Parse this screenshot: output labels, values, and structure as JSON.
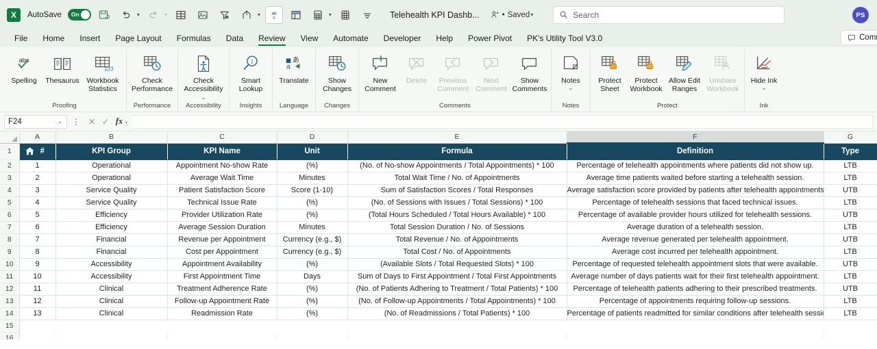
{
  "titlebar": {
    "app_logo": "X",
    "autosave_label": "AutoSave",
    "autosave_state": "On",
    "document_title": "Telehealth KPI Dashb...",
    "save_status": "Saved",
    "search_placeholder": "Search",
    "avatar_initials": "PS",
    "quick_access_icons": [
      "save-icon",
      "undo-icon",
      "redo-icon",
      "table-icon",
      "insert-picture-icon",
      "filter-icon",
      "share-icon",
      "spelling-icon",
      "pivot-table-icon",
      "calculation-icon",
      "sheet-icon",
      "customize-toolbar-icon"
    ]
  },
  "tabs": [
    {
      "label": "File",
      "active": false
    },
    {
      "label": "Home",
      "active": false
    },
    {
      "label": "Insert",
      "active": false
    },
    {
      "label": "Page Layout",
      "active": false
    },
    {
      "label": "Formulas",
      "active": false
    },
    {
      "label": "Data",
      "active": false
    },
    {
      "label": "Review",
      "active": true
    },
    {
      "label": "View",
      "active": false
    },
    {
      "label": "Automate",
      "active": false
    },
    {
      "label": "Developer",
      "active": false
    },
    {
      "label": "Help",
      "active": false
    },
    {
      "label": "Power Pivot",
      "active": false
    },
    {
      "label": "PK's Utility Tool V3.0",
      "active": false
    }
  ],
  "comments_button": "Comm",
  "ribbon": {
    "groups": [
      {
        "label": "Proofing",
        "buttons": [
          {
            "label": "Spelling",
            "icon": "spelling-abc-icon",
            "disabled": false,
            "caret": false
          },
          {
            "label": "Thesaurus",
            "icon": "thesaurus-book-icon",
            "disabled": false,
            "caret": false
          },
          {
            "label": "Workbook Statistics",
            "icon": "workbook-statistics-icon",
            "disabled": false,
            "caret": false
          }
        ]
      },
      {
        "label": "Performance",
        "buttons": [
          {
            "label": "Check Performance",
            "icon": "check-performance-icon",
            "disabled": false,
            "caret": false
          }
        ]
      },
      {
        "label": "Accessibility",
        "buttons": [
          {
            "label": "Check Accessibility",
            "icon": "check-accessibility-icon",
            "disabled": false,
            "caret": true
          }
        ]
      },
      {
        "label": "Insights",
        "buttons": [
          {
            "label": "Smart Lookup",
            "icon": "smart-lookup-icon",
            "disabled": false,
            "caret": false
          }
        ]
      },
      {
        "label": "Language",
        "buttons": [
          {
            "label": "Translate",
            "icon": "translate-icon",
            "disabled": false,
            "caret": false
          }
        ]
      },
      {
        "label": "Changes",
        "buttons": [
          {
            "label": "Show Changes",
            "icon": "show-changes-icon",
            "disabled": false,
            "caret": false
          }
        ]
      },
      {
        "label": "Comments",
        "buttons": [
          {
            "label": "New Comment",
            "icon": "new-comment-icon",
            "disabled": false,
            "caret": false
          },
          {
            "label": "Delete",
            "icon": "delete-comment-icon",
            "disabled": true,
            "caret": false
          },
          {
            "label": "Previous Comment",
            "icon": "previous-comment-icon",
            "disabled": true,
            "caret": false
          },
          {
            "label": "Next Comment",
            "icon": "next-comment-icon",
            "disabled": true,
            "caret": false
          },
          {
            "label": "Show Comments",
            "icon": "show-comments-icon",
            "disabled": false,
            "caret": false
          }
        ]
      },
      {
        "label": "Notes",
        "buttons": [
          {
            "label": "Notes",
            "icon": "notes-icon",
            "disabled": false,
            "caret": true
          }
        ]
      },
      {
        "label": "Protect",
        "buttons": [
          {
            "label": "Protect Sheet",
            "icon": "protect-sheet-icon",
            "disabled": false,
            "caret": false
          },
          {
            "label": "Protect Workbook",
            "icon": "protect-workbook-icon",
            "disabled": false,
            "caret": false
          },
          {
            "label": "Allow Edit Ranges",
            "icon": "allow-edit-ranges-icon",
            "disabled": false,
            "caret": false
          },
          {
            "label": "Unshare Workbook",
            "icon": "unshare-workbook-icon",
            "disabled": true,
            "caret": false
          }
        ]
      },
      {
        "label": "Ink",
        "buttons": [
          {
            "label": "Hide Ink",
            "icon": "hide-ink-icon",
            "disabled": false,
            "caret": true
          }
        ]
      }
    ]
  },
  "formula_bar": {
    "name_box": "F24",
    "formula_value": "",
    "cancel_icon": "cancel-icon",
    "enter_icon": "enter-icon",
    "fx_icon": "insert-function-icon"
  },
  "grid": {
    "column_letters": [
      "A",
      "B",
      "C",
      "D",
      "E",
      "F",
      "G"
    ],
    "selected_column": "F",
    "row_numbers": [
      "1",
      "2",
      "3",
      "4",
      "5",
      "6",
      "7",
      "8",
      "9",
      "10",
      "11",
      "12",
      "13",
      "14",
      "15",
      "16"
    ],
    "header_icon": "home-icon",
    "headers": [
      "#",
      "KPI Group",
      "KPI Name",
      "Unit",
      "Formula",
      "Definition",
      "Type"
    ],
    "rows": [
      {
        "num": "1",
        "group": "Operational",
        "name": "Appointment No-show Rate",
        "unit": "(%)",
        "formula": "(No. of No-show Appointments / Total Appointments) * 100",
        "definition": "Percentage of telehealth appointments where patients did not show up.",
        "type": "LTB"
      },
      {
        "num": "2",
        "group": "Operational",
        "name": "Average Wait Time",
        "unit": "Minutes",
        "formula": "Total Wait Time / No. of Appointments",
        "definition": "Average time patients waited before starting a telehealth session.",
        "type": "LTB"
      },
      {
        "num": "3",
        "group": "Service Quality",
        "name": "Patient Satisfaction Score",
        "unit": "Score (1-10)",
        "formula": "Sum of Satisfaction Scores / Total Responses",
        "definition": "Average satisfaction score provided by patients after telehealth appointments.",
        "type": "UTB"
      },
      {
        "num": "4",
        "group": "Service Quality",
        "name": "Technical Issue Rate",
        "unit": "(%)",
        "formula": "(No. of Sessions with Issues / Total Sessions) * 100",
        "definition": "Percentage of telehealth sessions that faced technical issues.",
        "type": "LTB"
      },
      {
        "num": "5",
        "group": "Efficiency",
        "name": "Provider Utilization Rate",
        "unit": "(%)",
        "formula": "(Total Hours Scheduled / Total Hours Available) * 100",
        "definition": "Percentage of available provider hours utilized for telehealth sessions.",
        "type": "UTB"
      },
      {
        "num": "6",
        "group": "Efficiency",
        "name": "Average Session Duration",
        "unit": "Minutes",
        "formula": "Total Session Duration / No. of Sessions",
        "definition": "Average duration of a telehealth session.",
        "type": "LTB"
      },
      {
        "num": "7",
        "group": "Financial",
        "name": "Revenue per Appointment",
        "unit": "Currency (e.g., $)",
        "formula": "Total Revenue / No. of Appointments",
        "definition": "Average revenue generated per telehealth appointment.",
        "type": "UTB"
      },
      {
        "num": "8",
        "group": "Financial",
        "name": "Cost per Appointment",
        "unit": "Currency (e.g., $)",
        "formula": "Total Cost / No. of Appointments",
        "definition": "Average cost incurred per telehealth appointment.",
        "type": "LTB"
      },
      {
        "num": "9",
        "group": "Accessibility",
        "name": "Appointment Availability",
        "unit": "(%)",
        "formula": "(Available Slots / Total Requested Slots) * 100",
        "definition": "Percentage of requested telehealth appointment slots that were available.",
        "type": "UTB"
      },
      {
        "num": "10",
        "group": "Accessibility",
        "name": "First Appointment Time",
        "unit": "Days",
        "formula": "Sum of Days to First Appointment / Total First Appointments",
        "definition": "Average number of days patients wait for their first telehealth appointment.",
        "type": "LTB"
      },
      {
        "num": "11",
        "group": "Clinical",
        "name": "Treatment Adherence Rate",
        "unit": "(%)",
        "formula": "(No. of Patients Adhering to Treatment / Total Patients) * 100",
        "definition": "Percentage of telehealth patients adhering to their prescribed treatments.",
        "type": "UTB"
      },
      {
        "num": "12",
        "group": "Clinical",
        "name": "Follow-up Appointment Rate",
        "unit": "(%)",
        "formula": "(No. of Follow-up Appointments / Total Appointments) * 100",
        "definition": "Percentage of appointments requiring follow-up sessions.",
        "type": "LTB"
      },
      {
        "num": "13",
        "group": "Clinical",
        "name": "Readmission Rate",
        "unit": "(%)",
        "formula": "(No. of Readmissions / Total Patients) * 100",
        "definition": "Percentage of patients readmitted for similar conditions after telehealth sessions.",
        "type": "LTB"
      }
    ]
  },
  "colors": {
    "header_bg": "#17485f",
    "ribbon_bg": "#f5f8f5",
    "titlebar_bg": "#e9efe9",
    "accent_green": "#107c41",
    "avatar_bg": "#4a50c4"
  }
}
